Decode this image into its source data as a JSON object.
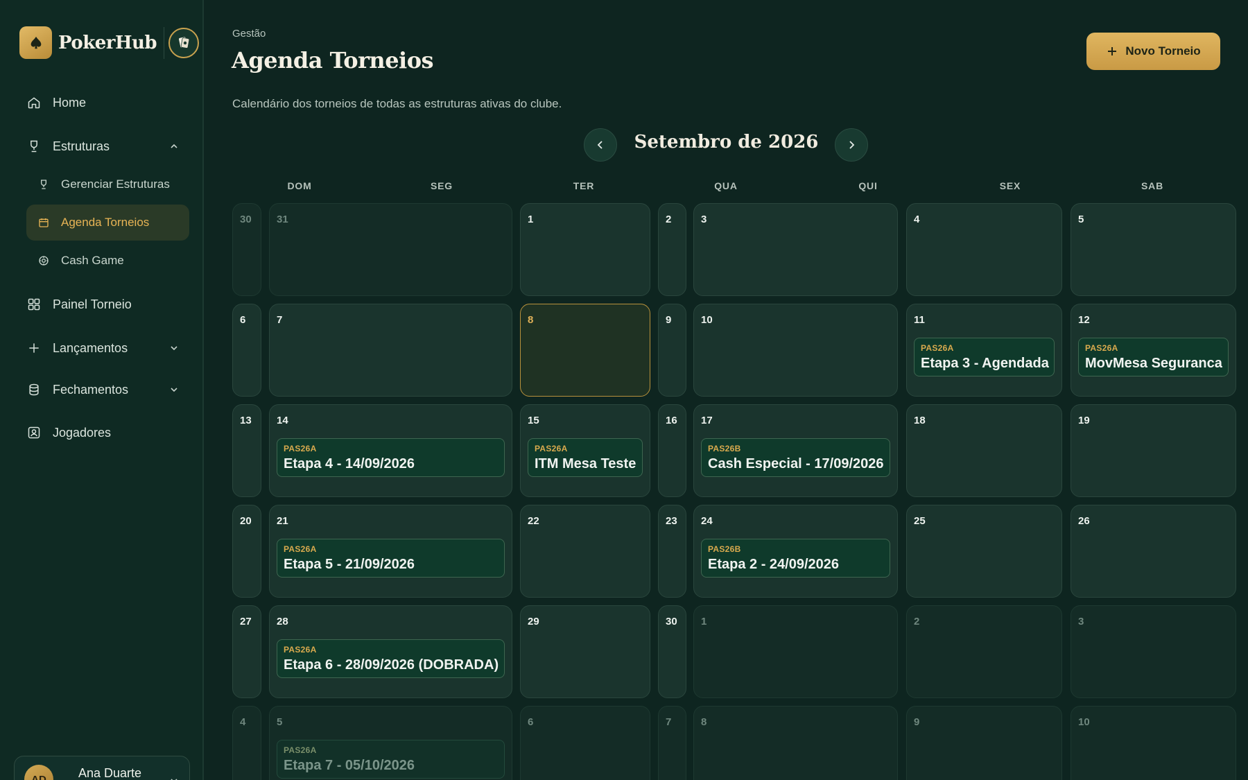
{
  "sidebar": {
    "brand": "PokerHub",
    "nav": {
      "home": "Home",
      "estruturas": "Estruturas",
      "gerenciar": "Gerenciar Estruturas",
      "agenda": "Agenda Torneios",
      "cash": "Cash Game",
      "painel": "Painel Torneio",
      "lancamentos": "Lançamentos",
      "fechamentos": "Fechamentos",
      "jogadores": "Jogadores"
    },
    "user": {
      "initials": "AD",
      "name": "Ana Duarte"
    }
  },
  "header": {
    "breadcrumb": "Gestão",
    "title": "Agenda Torneios",
    "subtitle": "Calendário dos torneios de todas as estruturas ativas do clube.",
    "new_button": "Novo Torneio"
  },
  "calendar": {
    "month_label": "Setembro de 2026",
    "weekdays": [
      "DOM",
      "SEG",
      "TER",
      "QUA",
      "QUI",
      "SEX",
      "SAB"
    ],
    "rows": [
      [
        {
          "day": "30",
          "dim": true
        },
        {
          "day": "31",
          "dim": true
        },
        {
          "day": "1"
        },
        {
          "day": "2"
        },
        {
          "day": "3"
        },
        {
          "day": "4"
        },
        {
          "day": "5"
        }
      ],
      [
        {
          "day": "6"
        },
        {
          "day": "7"
        },
        {
          "day": "8",
          "today": true
        },
        {
          "day": "9"
        },
        {
          "day": "10"
        },
        {
          "day": "11",
          "events": [
            {
              "code": "PAS26A",
              "name": "Etapa 3 - Agendada"
            }
          ]
        },
        {
          "day": "12",
          "events": [
            {
              "code": "PAS26A",
              "name": "MovMesa Seguranca"
            }
          ]
        }
      ],
      [
        {
          "day": "13"
        },
        {
          "day": "14",
          "events": [
            {
              "code": "PAS26A",
              "name": "Etapa 4 - 14/09/2026"
            }
          ]
        },
        {
          "day": "15",
          "events": [
            {
              "code": "PAS26A",
              "name": "ITM Mesa Teste"
            }
          ]
        },
        {
          "day": "16"
        },
        {
          "day": "17",
          "events": [
            {
              "code": "PAS26B",
              "name": "Cash Especial - 17/09/2026"
            }
          ]
        },
        {
          "day": "18"
        },
        {
          "day": "19"
        }
      ],
      [
        {
          "day": "20"
        },
        {
          "day": "21",
          "events": [
            {
              "code": "PAS26A",
              "name": "Etapa 5 - 21/09/2026"
            }
          ]
        },
        {
          "day": "22"
        },
        {
          "day": "23"
        },
        {
          "day": "24",
          "events": [
            {
              "code": "PAS26B",
              "name": "Etapa 2 - 24/09/2026"
            }
          ]
        },
        {
          "day": "25"
        },
        {
          "day": "26"
        }
      ],
      [
        {
          "day": "27"
        },
        {
          "day": "28",
          "events": [
            {
              "code": "PAS26A",
              "name": "Etapa 6 - 28/09/2026 (DOBRADA)"
            }
          ]
        },
        {
          "day": "29"
        },
        {
          "day": "30"
        },
        {
          "day": "1",
          "dim": true
        },
        {
          "day": "2",
          "dim": true
        },
        {
          "day": "3",
          "dim": true
        }
      ],
      [
        {
          "day": "4",
          "dim": true
        },
        {
          "day": "5",
          "dim": true,
          "events": [
            {
              "code": "PAS26A",
              "name": "Etapa 7 - 05/10/2026"
            }
          ]
        },
        {
          "day": "6",
          "dim": true
        },
        {
          "day": "7",
          "dim": true
        },
        {
          "day": "8",
          "dim": true
        },
        {
          "day": "9",
          "dim": true
        },
        {
          "day": "10",
          "dim": true
        }
      ]
    ]
  },
  "colors": {
    "accent": "#e0b660",
    "background": "#0e2520",
    "cell": "#1a342d",
    "event": "#0f3a2b"
  }
}
